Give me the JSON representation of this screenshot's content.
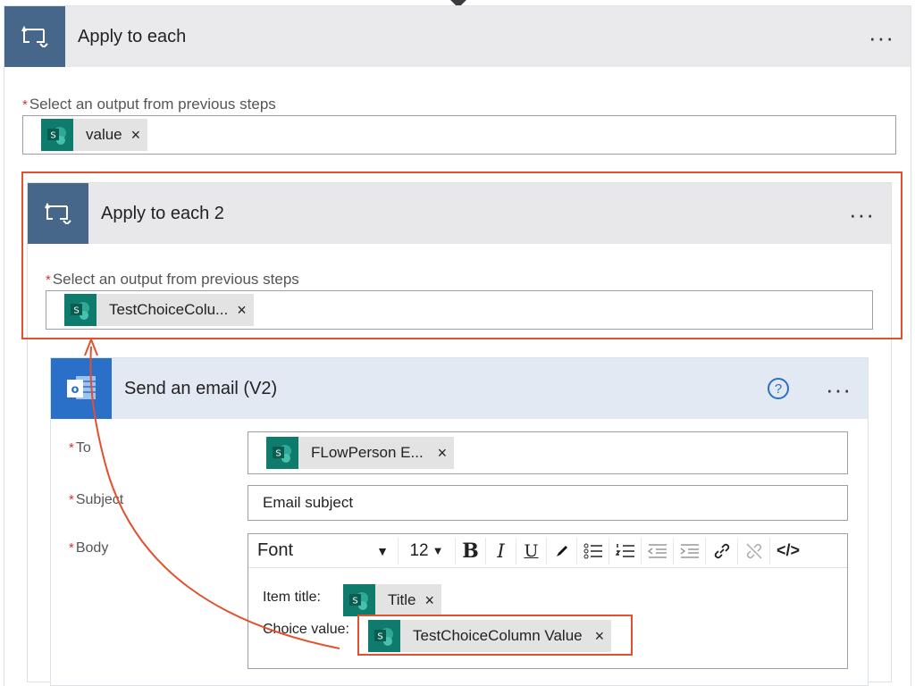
{
  "outer": {
    "title": "Apply to each",
    "field_label": "Select an output from previous steps",
    "token": "value",
    "more": "···"
  },
  "inner": {
    "title": "Apply to each 2",
    "field_label": "Select an output from previous steps",
    "token": "TestChoiceColu...",
    "more": "···"
  },
  "email": {
    "title": "Send an email (V2)",
    "help": "?",
    "more": "···",
    "to_label": "To",
    "to_token": "FLowPerson E...",
    "subject_label": "Subject",
    "subject_value": "Email subject",
    "body_label": "Body",
    "toolbar": {
      "font": "Font",
      "size": "12"
    },
    "body_lines": {
      "item_title_label": "Item title:",
      "item_title_token": "Title",
      "choice_label": "Choice value:",
      "choice_token": "TestChoiceColumn Value"
    }
  },
  "common": {
    "required_mark": "*",
    "token_remove": "×",
    "sp_letter": "S"
  },
  "colors": {
    "header_accent": "#466789",
    "email_accent": "#2a6fc8",
    "highlight": "#e2512f",
    "sharepoint": "#0f7b6c"
  },
  "icons": {
    "loop": "loop-icon",
    "outlook": "outlook-icon",
    "sharepoint": "sharepoint-icon"
  }
}
